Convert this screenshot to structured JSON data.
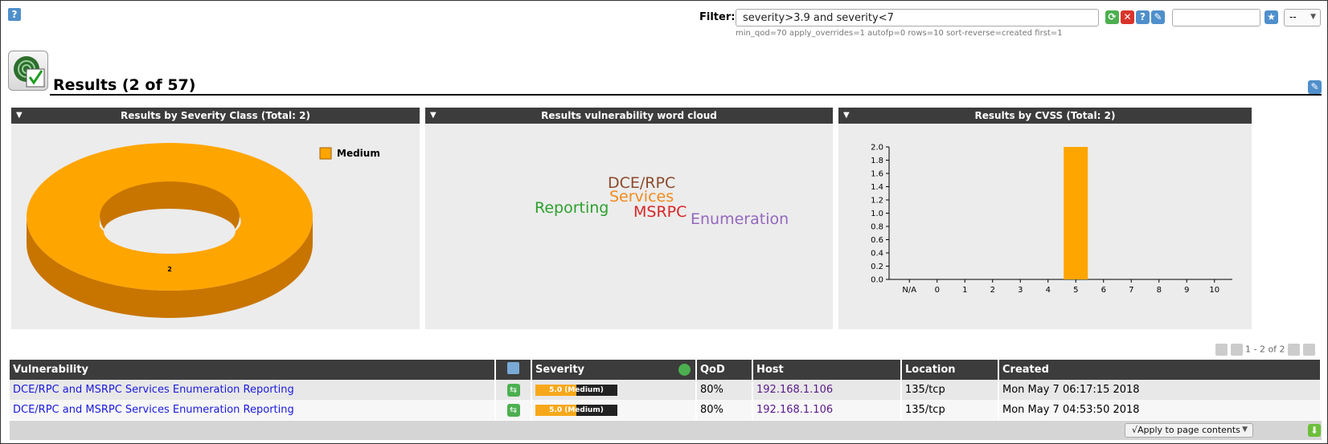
{
  "filter": {
    "label": "Filter:",
    "value": "severity>3.9 and severity<7",
    "params": "min_qod=70 apply_overrides=1 autofp=0 rows=10 sort-reverse=created first=1"
  },
  "page": {
    "title": "Results (2 of 57)",
    "select_value": "--"
  },
  "panels": {
    "severity_title": "Results by Severity Class (Total: 2)",
    "wordcloud_title": "Results vulnerability word cloud",
    "cvss_title": "Results by CVSS (Total: 2)"
  },
  "wordcloud": {
    "words": [
      {
        "text": "DCE/RPC",
        "color": "#8b4a2b"
      },
      {
        "text": "Services",
        "color": "#f28a1e"
      },
      {
        "text": "Reporting",
        "color": "#2ca02c"
      },
      {
        "text": "MSRPC",
        "color": "#d62728"
      },
      {
        "text": "Enumeration",
        "color": "#9467bd"
      }
    ]
  },
  "chart_data": [
    {
      "type": "pie",
      "title": "Results by Severity Class (Total: 2)",
      "categories": [
        "Medium"
      ],
      "values": [
        2
      ],
      "legend": [
        "Medium"
      ],
      "colors": [
        "#ffa500"
      ],
      "legend_position": "top-right"
    },
    {
      "type": "bar",
      "title": "Results by CVSS (Total: 2)",
      "categories": [
        "N/A",
        "0",
        "1",
        "2",
        "3",
        "4",
        "5",
        "6",
        "7",
        "8",
        "9",
        "10"
      ],
      "values": [
        0,
        0,
        0,
        0,
        0,
        0,
        2,
        0,
        0,
        0,
        0,
        0
      ],
      "yticks": [
        "0.0",
        "0.2",
        "0.4",
        "0.6",
        "0.8",
        "1.0",
        "1.2",
        "1.4",
        "1.6",
        "1.8",
        "2.0"
      ],
      "ylim": [
        0,
        2
      ],
      "color": "#ffa500"
    }
  ],
  "pagination": {
    "text": "1 - 2 of 2"
  },
  "table": {
    "headers": {
      "vulnerability": "Vulnerability",
      "severity": "Severity",
      "qod": "QoD",
      "host": "Host",
      "location": "Location",
      "created": "Created"
    },
    "rows": [
      {
        "vulnerability": "DCE/RPC and MSRPC Services Enumeration Reporting",
        "severity_label": "5.0 (Medium)",
        "severity_fraction": 0.5,
        "qod": "80%",
        "host": "192.168.1.106",
        "location": "135/tcp",
        "created": "Mon May 7 06:17:15 2018"
      },
      {
        "vulnerability": "DCE/RPC and MSRPC Services Enumeration Reporting",
        "severity_label": "5.0 (Medium)",
        "severity_fraction": 0.5,
        "qod": "80%",
        "host": "192.168.1.106",
        "location": "135/tcp",
        "created": "Mon May 7 04:53:50 2018"
      }
    ]
  },
  "footer": {
    "apply_label": "√Apply to page contents"
  }
}
